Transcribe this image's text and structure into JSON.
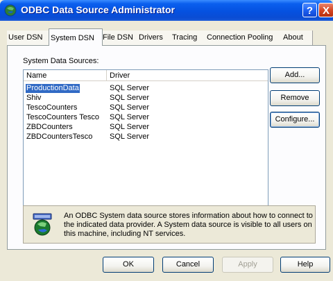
{
  "window": {
    "title": "ODBC Data Source Administrator"
  },
  "titlebar_buttons": {
    "help": "?",
    "close": "X"
  },
  "tabs": [
    {
      "label": "User DSN"
    },
    {
      "label": "System DSN"
    },
    {
      "label": "File DSN"
    },
    {
      "label": "Drivers"
    },
    {
      "label": "Tracing"
    },
    {
      "label": "Connection Pooling"
    },
    {
      "label": "About"
    }
  ],
  "active_tab": "System DSN",
  "system_sources": {
    "label": "System Data Sources:",
    "columns": {
      "name": "Name",
      "driver": "Driver"
    },
    "rows": [
      {
        "name": "ProductionData",
        "driver": "SQL Server"
      },
      {
        "name": "Shiv",
        "driver": "SQL Server"
      },
      {
        "name": "TescoCounters",
        "driver": "SQL Server"
      },
      {
        "name": "TescoCounters Tesco",
        "driver": "SQL Server"
      },
      {
        "name": "ZBDCounters",
        "driver": "SQL Server"
      },
      {
        "name": "ZBDCountersTesco",
        "driver": "SQL Server"
      }
    ],
    "selected_row": "ProductionData"
  },
  "side_buttons": {
    "add": "Add...",
    "remove": "Remove",
    "configure": "Configure..."
  },
  "info": {
    "text": "An ODBC System data source stores information about how to connect to the indicated data provider.   A System data source is visible to all users on this machine, including NT services.",
    "icon": "database-globe-icon"
  },
  "footer_buttons": {
    "ok": "OK",
    "cancel": "Cancel",
    "apply": "Apply",
    "help": "Help"
  },
  "colors": {
    "title_blue": "#0551E0",
    "selection": "#316AC5",
    "face": "#ECE9D8"
  }
}
